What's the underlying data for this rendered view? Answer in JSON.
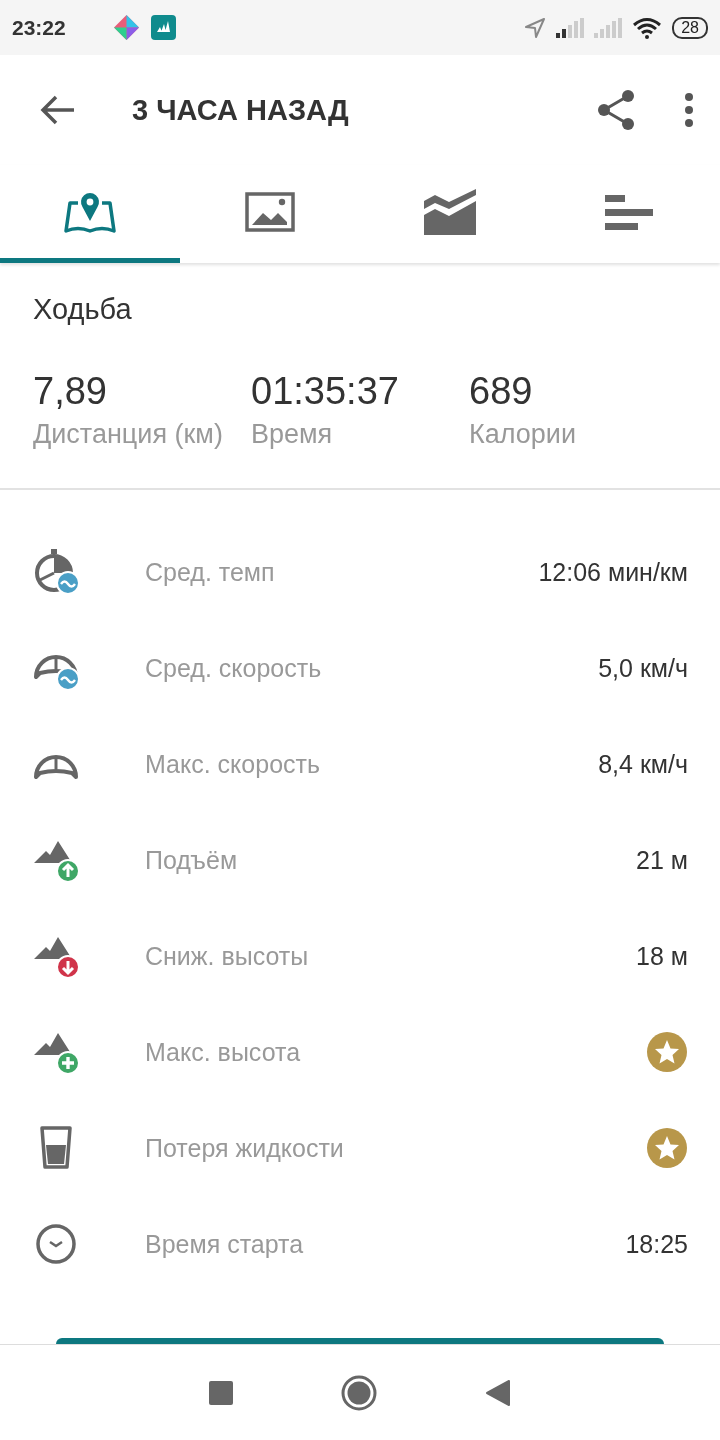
{
  "status_bar": {
    "time": "23:22",
    "battery": "28"
  },
  "app_bar": {
    "title": "3 ЧАСА НАЗАД"
  },
  "tabs": [
    {
      "kind": "map",
      "selected": true
    },
    {
      "kind": "photo",
      "selected": false
    },
    {
      "kind": "chart",
      "selected": false
    },
    {
      "kind": "bars",
      "selected": false
    }
  ],
  "activity": "Ходьба",
  "summary": [
    {
      "value": "7,89",
      "label": "Дистанция (км)"
    },
    {
      "value": "01:35:37",
      "label": "Время"
    },
    {
      "value": "689",
      "label": "Калории"
    }
  ],
  "metrics": [
    {
      "kind": "pace",
      "label": "Сред. темп",
      "value": "12:06 мин/км",
      "locked": false
    },
    {
      "kind": "avg-speed",
      "label": "Сред. скорость",
      "value": "5,0 км/ч",
      "locked": false
    },
    {
      "kind": "max-speed",
      "label": "Макс. скорость",
      "value": "8,4 км/ч",
      "locked": false
    },
    {
      "kind": "ascent",
      "label": "Подъём",
      "value": "21 м",
      "locked": false
    },
    {
      "kind": "descent",
      "label": "Сниж. высоты",
      "value": "18 м",
      "locked": false
    },
    {
      "kind": "max-altitude",
      "label": "Макс. высота",
      "locked": true
    },
    {
      "kind": "fluid",
      "label": "Потеря жидкости",
      "locked": true
    },
    {
      "kind": "start",
      "label": "Время старта",
      "value": "18:25",
      "locked": false
    }
  ]
}
